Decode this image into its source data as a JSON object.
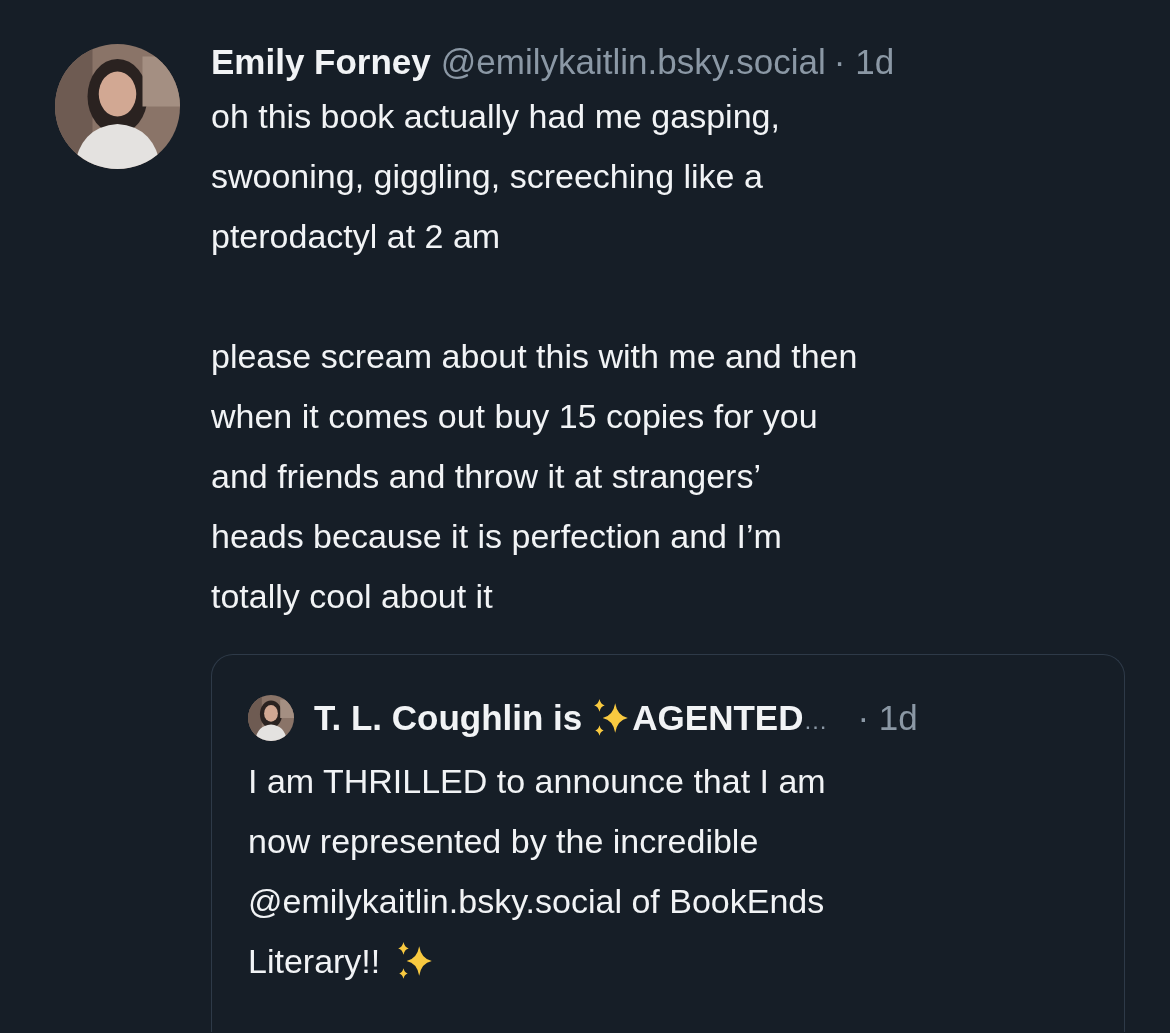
{
  "post": {
    "author": "Emily Forney",
    "handle": "@emilykaitlin.bsky.social",
    "time": "· 1d",
    "text": "oh this book actually had me gasping,\nswooning, giggling, screeching like a\npterodactyl at 2 am\n\nplease scream about this with me and then\nwhen it comes out buy 15 copies for you\nand friends and throw it at strangers’\nheads because it is perfection and I’m\ntotally cool about it",
    "quote": {
      "author": "T. L. Coughlin is",
      "author_rest": "AGENTED",
      "ellipsis": "…",
      "time": "· 1d",
      "lines": [
        "I am THRILLED to announce that I am",
        "now represented by the incredible",
        "@emilykaitlin.bsky.social of BookEnds",
        "Literary!!"
      ]
    }
  }
}
